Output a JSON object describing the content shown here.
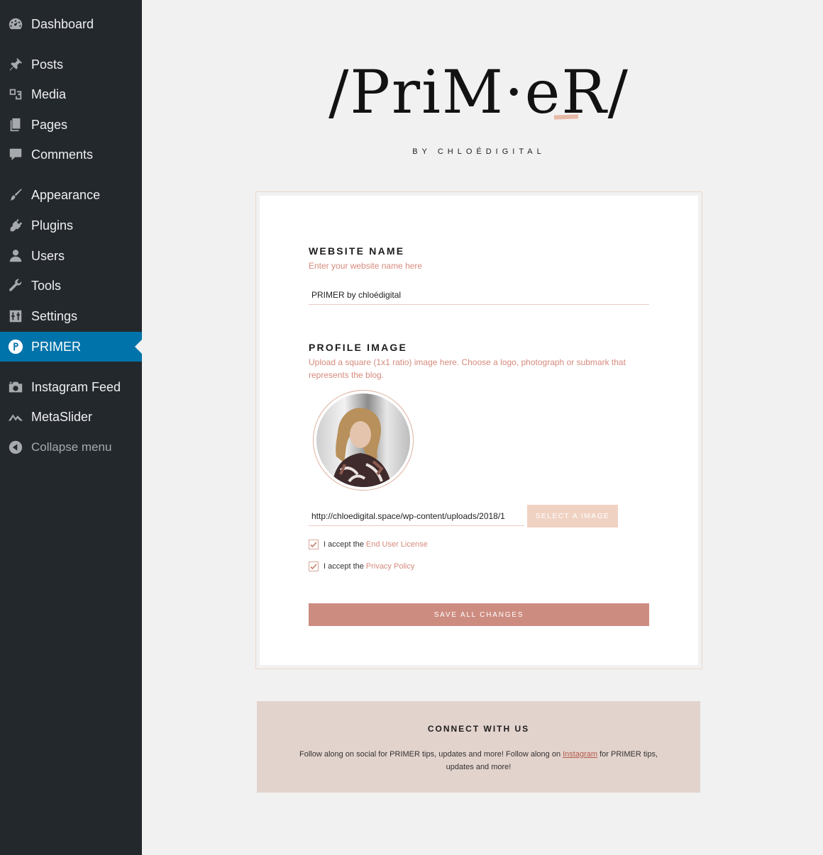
{
  "sidebar": {
    "items": [
      {
        "label": "Dashboard",
        "icon": "dashboard-icon"
      },
      {
        "label": "Posts",
        "icon": "pin-icon"
      },
      {
        "label": "Media",
        "icon": "media-icon"
      },
      {
        "label": "Pages",
        "icon": "pages-icon"
      },
      {
        "label": "Comments",
        "icon": "comment-icon"
      },
      {
        "label": "Appearance",
        "icon": "brush-icon"
      },
      {
        "label": "Plugins",
        "icon": "plug-icon"
      },
      {
        "label": "Users",
        "icon": "user-icon"
      },
      {
        "label": "Tools",
        "icon": "wrench-icon"
      },
      {
        "label": "Settings",
        "icon": "settings-icon"
      },
      {
        "label": "PRIMER",
        "icon": "primer-logo-icon",
        "active": true
      },
      {
        "label": "Instagram Feed",
        "icon": "camera-icon"
      },
      {
        "label": "MetaSlider",
        "icon": "mountain-icon"
      },
      {
        "label": "Collapse menu",
        "icon": "collapse-icon"
      }
    ]
  },
  "logo": {
    "wordmark": "/PriM·eR/",
    "subtitle": "BY CHLOÉDIGITAL"
  },
  "form": {
    "website_name": {
      "title": "WEBSITE NAME",
      "description": "Enter your website name here",
      "value": "PRIMER by chloédigital"
    },
    "profile_image": {
      "title": "PROFILE IMAGE",
      "description": "Upload a square (1x1 ratio) image here. Choose a logo, photograph or submark that represents the blog.",
      "url_value": "http://chloedigital.space/wp-content/uploads/2018/1",
      "select_button": "SELECT A IMAGE"
    },
    "checks": [
      {
        "prefix": "I accept the",
        "link": "End User License",
        "checked": true
      },
      {
        "prefix": "I accept the",
        "link": "Privacy Policy",
        "checked": true
      }
    ],
    "save_button": "SAVE ALL CHANGES"
  },
  "connect": {
    "title": "CONNECT WITH US",
    "text_before": "Follow along on social for PRIMER tips, updates and more! Follow along on",
    "link": "Instagram",
    "text_after": "for PRIMER tips, updates and more!"
  },
  "colors": {
    "sidebar_bg": "#23282d",
    "active_bg": "#0073aa",
    "accent": "#d68a7c",
    "save_button": "#cd8c80",
    "select_button": "#f0d2c3",
    "connect_bg": "#e3d3cd"
  }
}
